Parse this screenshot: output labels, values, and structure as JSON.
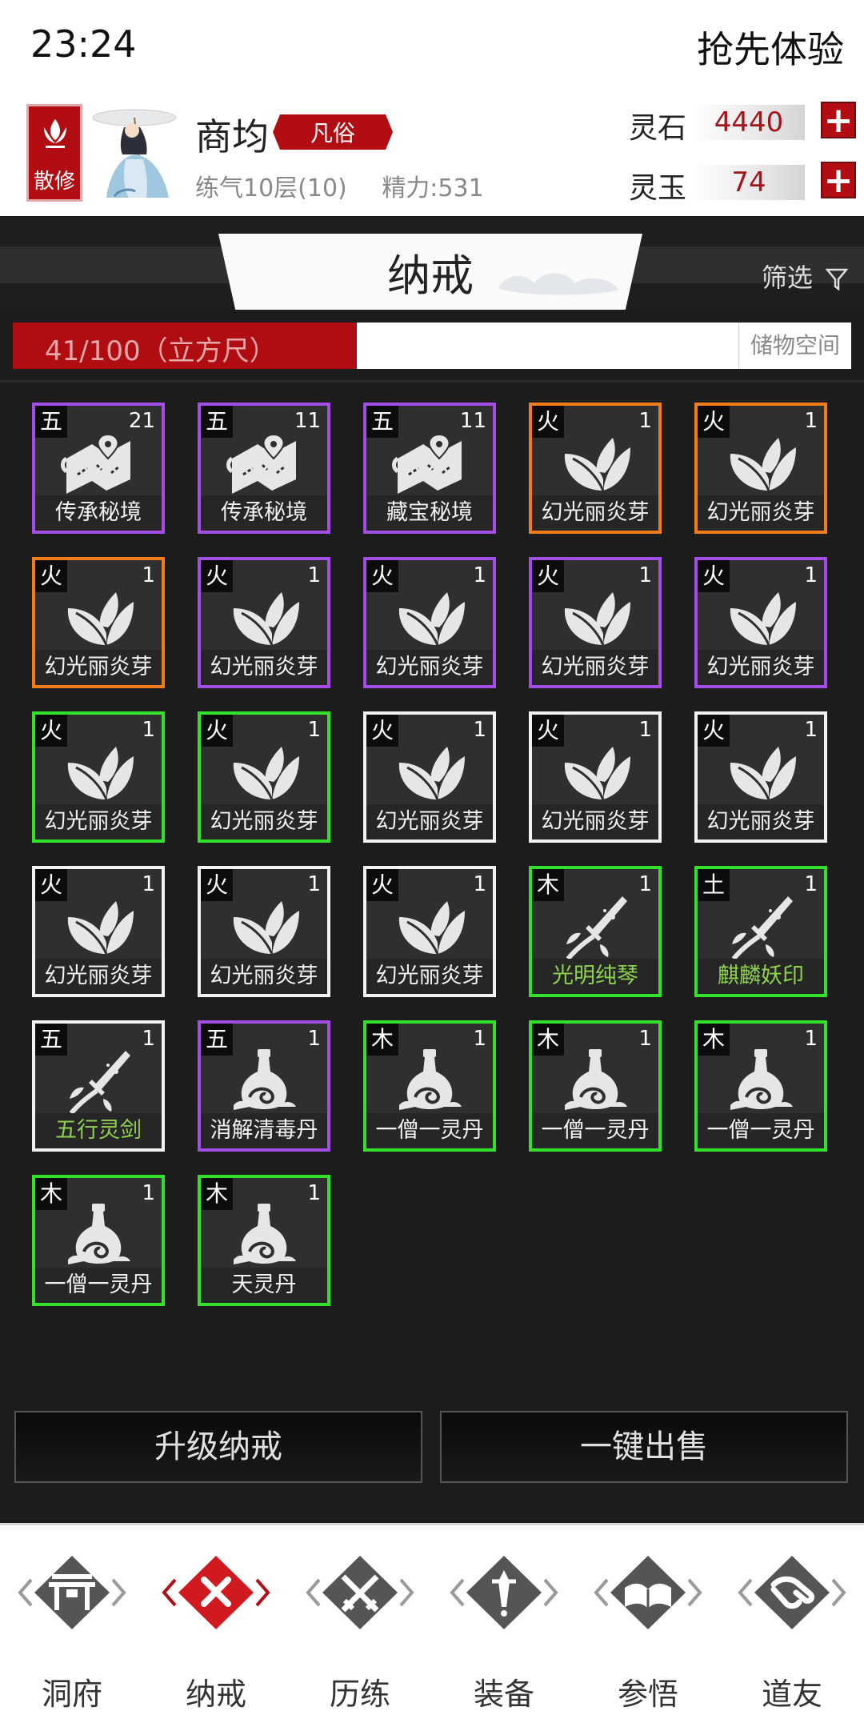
{
  "status": {
    "time": "23:24",
    "preview": "抢先体验"
  },
  "profile": {
    "badge": "散修",
    "name": "商均",
    "rank": "凡俗",
    "level": "练气10层(10)",
    "energy": "精力:531"
  },
  "resources": [
    {
      "label": "灵石",
      "value": "4440"
    },
    {
      "label": "灵玉",
      "value": "74"
    }
  ],
  "panel": {
    "title": "纳戒",
    "filter": "筛选",
    "capacity_text": "41/100（立方尺）",
    "capacity_fraction": 0.41,
    "storage_label": "储物空间"
  },
  "items": [
    {
      "el": "五",
      "qty": "21",
      "name": "传承秘境",
      "icon": "scroll-map",
      "rarity": "purple"
    },
    {
      "el": "五",
      "qty": "11",
      "name": "传承秘境",
      "icon": "scroll-map",
      "rarity": "purple"
    },
    {
      "el": "五",
      "qty": "11",
      "name": "藏宝秘境",
      "icon": "scroll-map",
      "rarity": "purple"
    },
    {
      "el": "火",
      "qty": "1",
      "name": "幻光丽炎芽",
      "icon": "leaf",
      "rarity": "orange"
    },
    {
      "el": "火",
      "qty": "1",
      "name": "幻光丽炎芽",
      "icon": "leaf",
      "rarity": "orange"
    },
    {
      "el": "火",
      "qty": "1",
      "name": "幻光丽炎芽",
      "icon": "leaf",
      "rarity": "orange"
    },
    {
      "el": "火",
      "qty": "1",
      "name": "幻光丽炎芽",
      "icon": "leaf",
      "rarity": "purple"
    },
    {
      "el": "火",
      "qty": "1",
      "name": "幻光丽炎芽",
      "icon": "leaf",
      "rarity": "purple"
    },
    {
      "el": "火",
      "qty": "1",
      "name": "幻光丽炎芽",
      "icon": "leaf",
      "rarity": "purple"
    },
    {
      "el": "火",
      "qty": "1",
      "name": "幻光丽炎芽",
      "icon": "leaf",
      "rarity": "purple"
    },
    {
      "el": "火",
      "qty": "1",
      "name": "幻光丽炎芽",
      "icon": "leaf",
      "rarity": "green"
    },
    {
      "el": "火",
      "qty": "1",
      "name": "幻光丽炎芽",
      "icon": "leaf",
      "rarity": "green"
    },
    {
      "el": "火",
      "qty": "1",
      "name": "幻光丽炎芽",
      "icon": "leaf",
      "rarity": "white"
    },
    {
      "el": "火",
      "qty": "1",
      "name": "幻光丽炎芽",
      "icon": "leaf",
      "rarity": "white"
    },
    {
      "el": "火",
      "qty": "1",
      "name": "幻光丽炎芽",
      "icon": "leaf",
      "rarity": "white"
    },
    {
      "el": "火",
      "qty": "1",
      "name": "幻光丽炎芽",
      "icon": "leaf",
      "rarity": "white"
    },
    {
      "el": "火",
      "qty": "1",
      "name": "幻光丽炎芽",
      "icon": "leaf",
      "rarity": "white"
    },
    {
      "el": "火",
      "qty": "1",
      "name": "幻光丽炎芽",
      "icon": "leaf",
      "rarity": "white"
    },
    {
      "el": "木",
      "qty": "1",
      "name": "光明纯琴",
      "icon": "artifact",
      "rarity": "green",
      "name_green": true
    },
    {
      "el": "土",
      "qty": "1",
      "name": "麒麟妖印",
      "icon": "artifact",
      "rarity": "green",
      "name_green": true
    },
    {
      "el": "五",
      "qty": "1",
      "name": "五行灵剑",
      "icon": "artifact",
      "rarity": "white",
      "name_green": true
    },
    {
      "el": "五",
      "qty": "1",
      "name": "消解清毒丹",
      "icon": "gourd",
      "rarity": "purple"
    },
    {
      "el": "木",
      "qty": "1",
      "name": "一僧一灵丹",
      "icon": "gourd",
      "rarity": "green"
    },
    {
      "el": "木",
      "qty": "1",
      "name": "一僧一灵丹",
      "icon": "gourd",
      "rarity": "green"
    },
    {
      "el": "木",
      "qty": "1",
      "name": "一僧一灵丹",
      "icon": "gourd",
      "rarity": "green"
    },
    {
      "el": "木",
      "qty": "1",
      "name": "一僧一灵丹",
      "icon": "gourd",
      "rarity": "green"
    },
    {
      "el": "木",
      "qty": "1",
      "name": "天灵丹",
      "icon": "gourd",
      "rarity": "green"
    }
  ],
  "actions": {
    "upgrade": "升级纳戒",
    "sell_all": "一键出售"
  },
  "nav": [
    {
      "label": "洞府",
      "icon": "gate-icon",
      "active": false
    },
    {
      "label": "纳戒",
      "icon": "close-x-icon",
      "active": true
    },
    {
      "label": "历练",
      "icon": "crossed-swords-icon",
      "active": false
    },
    {
      "label": "装备",
      "icon": "dagger-icon",
      "active": false
    },
    {
      "label": "参悟",
      "icon": "open-book-icon",
      "active": false
    },
    {
      "label": "道友",
      "icon": "handshake-icon",
      "active": false
    }
  ],
  "colors": {
    "accent_red": "#b30d14",
    "rarity_purple": "#a24ee6",
    "rarity_orange": "#f07d1a",
    "rarity_green": "#34e02a",
    "rarity_white": "#f2f2f2"
  }
}
